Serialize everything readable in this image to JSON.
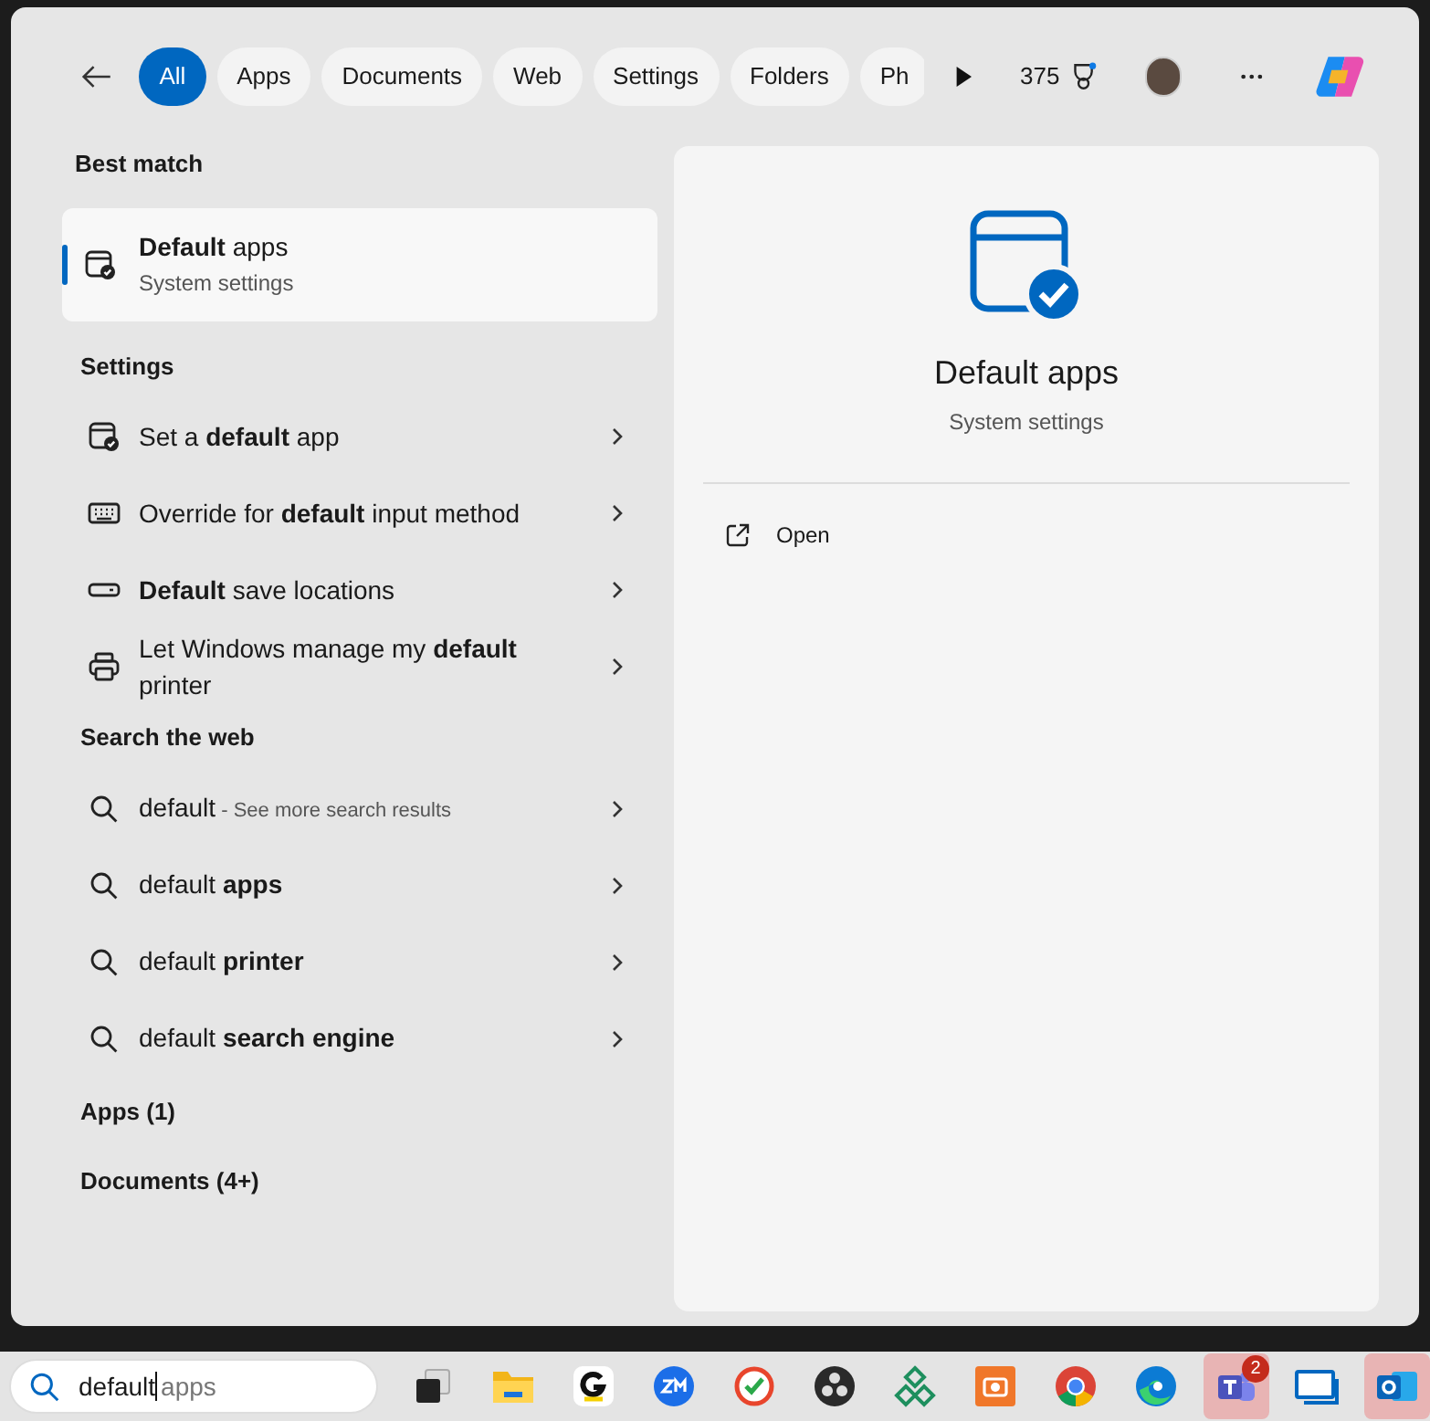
{
  "filters": [
    {
      "label": "All",
      "selected": true
    },
    {
      "label": "Apps",
      "selected": false
    },
    {
      "label": "Documents",
      "selected": false
    },
    {
      "label": "Web",
      "selected": false
    },
    {
      "label": "Settings",
      "selected": false
    },
    {
      "label": "Folders",
      "selected": false
    },
    {
      "label": "Ph",
      "selected": false
    }
  ],
  "points": "375",
  "best_match": {
    "heading": "Best match",
    "title": "**Default** apps",
    "subtitle": "System settings",
    "selected": true
  },
  "settings": {
    "heading": "Settings",
    "items": [
      {
        "kind": "app-check",
        "label": "Set a **default** app"
      },
      {
        "kind": "keyboard",
        "label": "Override for **default** input method"
      },
      {
        "kind": "drive",
        "label": "**Default** save locations"
      },
      {
        "kind": "printer",
        "label": "Let Windows manage my **default** printer"
      }
    ]
  },
  "web": {
    "heading": "Search the web",
    "items": [
      {
        "query": "default",
        "hint": "- See more search results"
      },
      {
        "query": "default **apps**"
      },
      {
        "query": "default **printer**"
      },
      {
        "query": "default **search engine**"
      }
    ]
  },
  "more_sections": [
    "Apps (1)",
    "Documents (4+)"
  ],
  "preview": {
    "title": "Default apps",
    "subtitle": "System settings",
    "actions": [
      {
        "label": "Open"
      }
    ]
  },
  "taskbar": {
    "search": {
      "value": "default",
      "suggestion": "apps"
    },
    "apps": [
      {
        "kind": "task-view",
        "flashing": false
      },
      {
        "kind": "folder",
        "flashing": false
      },
      {
        "kind": "g-app",
        "flashing": false
      },
      {
        "kind": "zm",
        "flashing": false
      },
      {
        "kind": "check-circle",
        "flashing": false
      },
      {
        "kind": "obs",
        "flashing": false
      },
      {
        "kind": "diamond",
        "flashing": false
      },
      {
        "kind": "camera",
        "flashing": false
      },
      {
        "kind": "chrome",
        "flashing": false
      },
      {
        "kind": "edge",
        "flashing": false
      },
      {
        "kind": "teams",
        "flashing": true,
        "badge": "2"
      },
      {
        "kind": "monitor",
        "flashing": false
      },
      {
        "kind": "mail",
        "flashing": true
      }
    ]
  }
}
